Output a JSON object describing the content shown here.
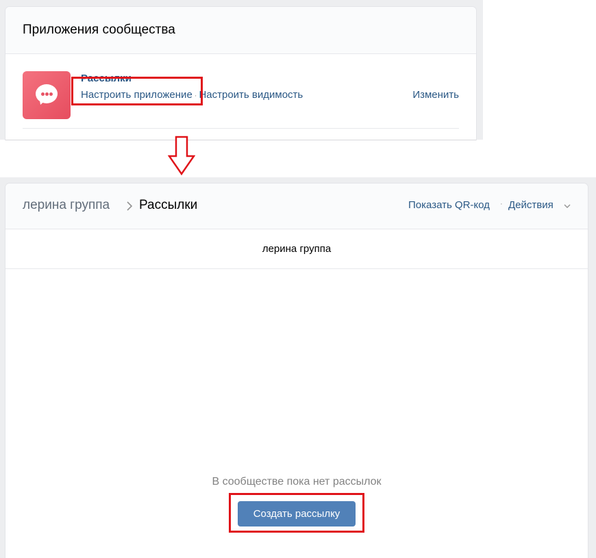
{
  "top_panel": {
    "title": "Приложения сообщества",
    "app": {
      "icon": "chat-bubble-icon",
      "name": "Рассылки",
      "configure_link": "Настроить приложение",
      "separator": "·",
      "visibility_link": "Настроить видимость",
      "change_link": "Изменить"
    }
  },
  "arrow": {
    "icon": "down-arrow-icon",
    "color": "#e0141a"
  },
  "bottom_panel": {
    "breadcrumb": {
      "group": "лерина группа",
      "current": "Рассылки"
    },
    "header_actions": {
      "qr_link": "Показать QR-код",
      "separator": "·",
      "actions_link": "Действия"
    },
    "subheader_title": "лерина группа",
    "empty_state_text": "В сообществе пока нет рассылок",
    "create_button": "Создать рассылку"
  },
  "colors": {
    "link": "#2a5885",
    "button": "#5181b8",
    "highlight": "#e0141a",
    "icon_gradient_start": "#f4727f",
    "icon_gradient_end": "#e64d5f"
  }
}
